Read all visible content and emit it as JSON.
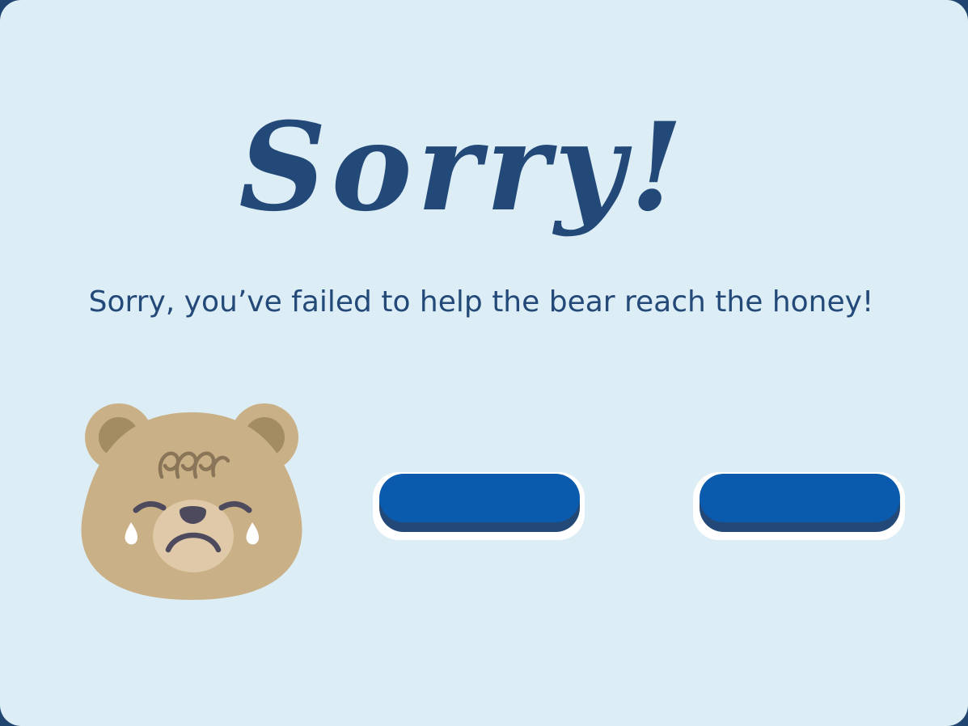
{
  "screen": {
    "title": "Sorry!",
    "message": "Sorry, you’ve failed to help the bear reach the honey!"
  },
  "illustration": {
    "icon": "crying-bear-icon"
  },
  "buttons": [
    {
      "name": "left-action-button",
      "label": ""
    },
    {
      "name": "right-action-button",
      "label": ""
    }
  ],
  "colors": {
    "background": "#dcedf5",
    "text": "#234978",
    "button": "#0a5bad",
    "button_shadow": "#234978",
    "bear_fur": "#c9b086"
  }
}
